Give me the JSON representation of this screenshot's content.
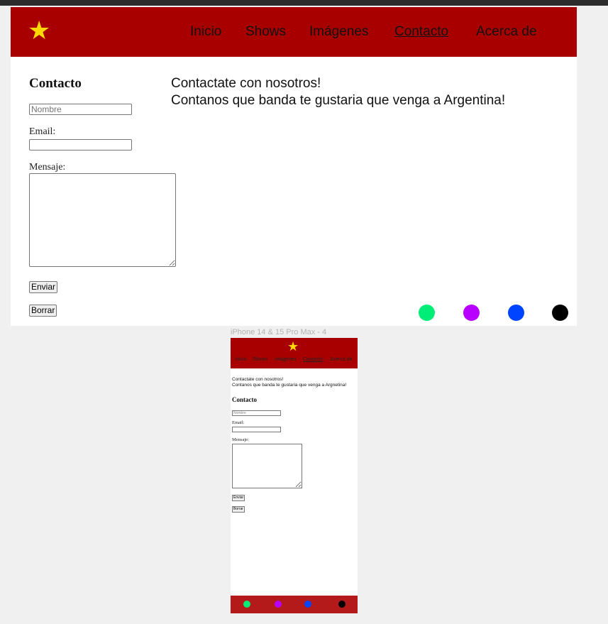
{
  "desktop": {
    "logo_icon": "star-icon",
    "nav": [
      "Inicio",
      "Shows",
      "Imágenes",
      "Contacto",
      "Acerca de"
    ],
    "nav_active": "Contacto",
    "intro_line1": "Contactate con nosotros!",
    "intro_line2": "Contanos que banda te gustaria que venga a Argentina!",
    "form_title": "Contacto",
    "name_placeholder": "Nombre",
    "email_label": "Email:",
    "message_label": "Mensaje:",
    "submit_label": "Enviar",
    "reset_label": "Borrar",
    "dots": [
      "#00ee77",
      "#b700ff",
      "#0044ff",
      "#000000"
    ]
  },
  "mobile": {
    "frame_label": "iPhone 14 & 15 Pro Max - 4",
    "nav": [
      "Inicio",
      "Shows",
      "Imágenes",
      "Contacto",
      "Acerca de"
    ],
    "nav_active": "Contacto",
    "intro_line1": "Contactate con nosotros!",
    "intro_line2": "Contanos que banda te gustaria que venga a Argnetina!",
    "form_title": "Contacto",
    "name_placeholder": "Nombre",
    "email_label": "Email:",
    "message_label": "Mensaje:",
    "submit_label": "Enviar",
    "reset_label": "Borrar",
    "dots": [
      "#00ee77",
      "#b700ff",
      "#0044ff",
      "#000000"
    ]
  },
  "colors": {
    "header": "#a80000",
    "mobile_footer": "#b51a1a",
    "star": "#ffd700"
  }
}
